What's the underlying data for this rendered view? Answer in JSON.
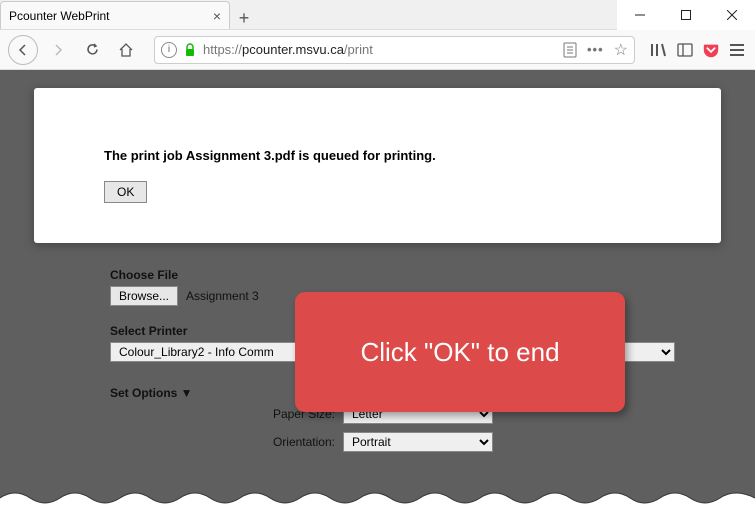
{
  "browser": {
    "tab_title": "Pcounter WebPrint",
    "url_prefix": "https://",
    "url_domain": "pcounter.msvu.ca",
    "url_path": "/print"
  },
  "dialog": {
    "message": "The print job Assignment 3.pdf is queued for printing.",
    "ok_label": "OK"
  },
  "form": {
    "choose_file_label": "Choose File",
    "browse_label": "Browse...",
    "filename": "Assignment 3",
    "select_printer_label": "Select Printer",
    "printer_value": "Colour_Library2 - Info Comm",
    "set_options_label": "Set Options ▼",
    "paper_size_label": "Paper Size:",
    "paper_size_value": "Letter",
    "orientation_label": "Orientation:",
    "orientation_value": "Portrait"
  },
  "callout": {
    "text": "Click \"OK\" to end"
  }
}
